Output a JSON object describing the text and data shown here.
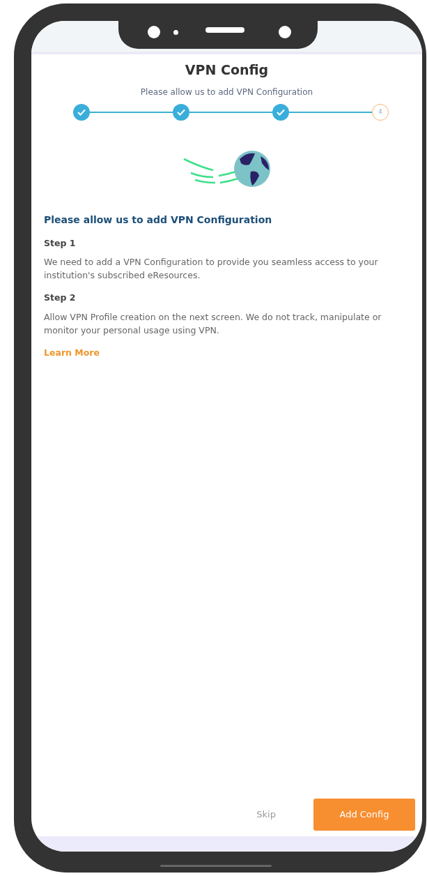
{
  "header": {
    "title": "VPN Config",
    "subtitle": "Please allow us to add VPN Configuration"
  },
  "steps": [
    {
      "done": true
    },
    {
      "done": true
    },
    {
      "done": true
    },
    {
      "label": "4",
      "done": false
    }
  ],
  "content": {
    "heading": "Please allow us to add VPN Configuration",
    "sections": [
      {
        "title": "Step 1",
        "text": "We need to add a VPN Configuration to provide you seamless access to your institution's subscribed eResources."
      },
      {
        "title": "Step 2",
        "text": "Allow VPN Profile creation on the next screen. We do not track, manipulate or monitor your personal usage using VPN."
      }
    ],
    "link": "Learn More"
  },
  "buttons": [
    {
      "label": "Skip",
      "kind": "text"
    },
    {
      "label": "Add Config",
      "kind": "primary"
    }
  ]
}
